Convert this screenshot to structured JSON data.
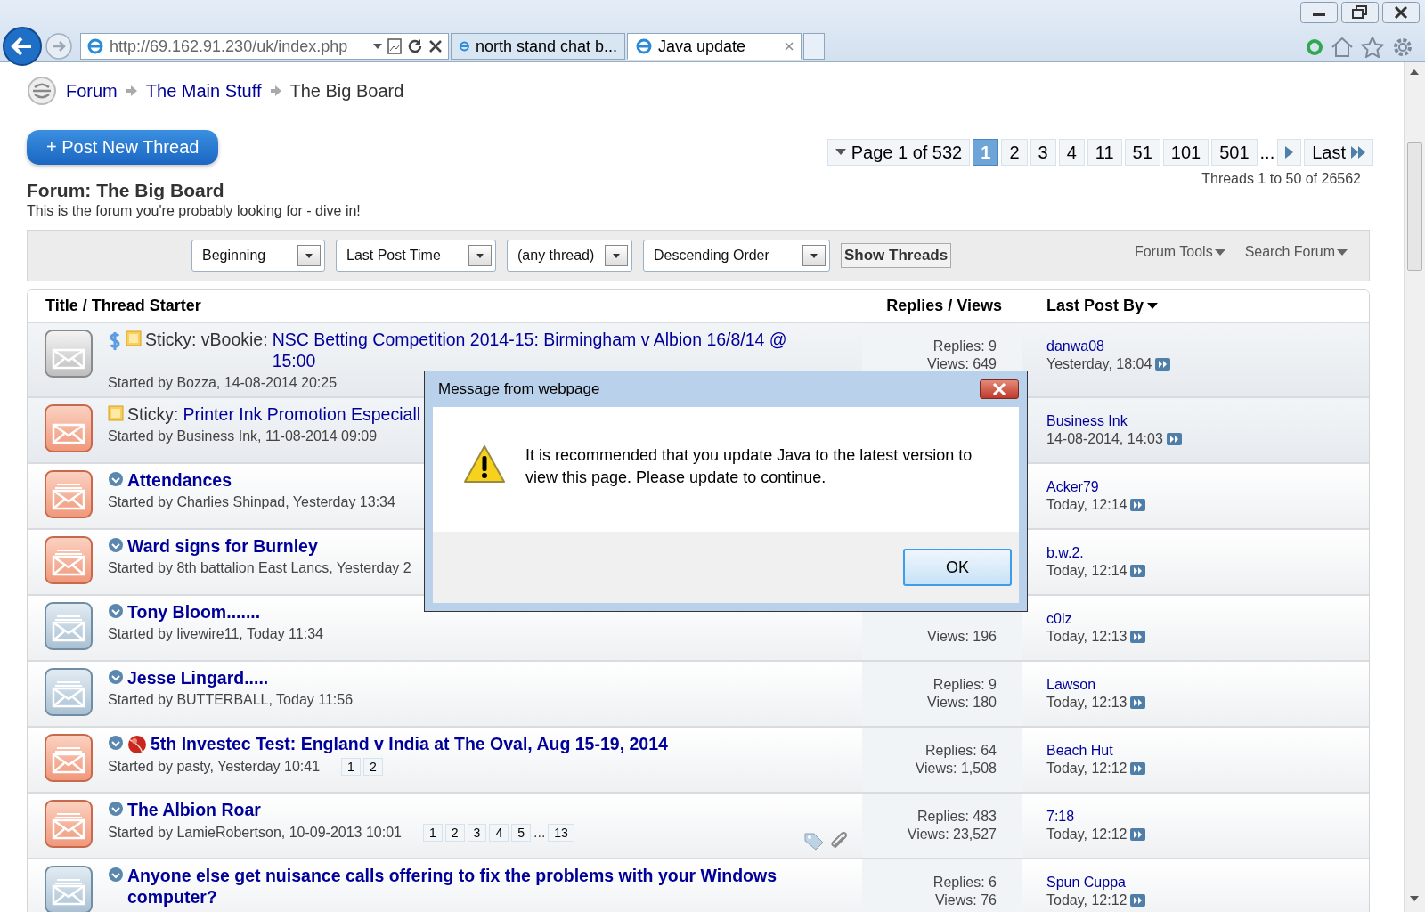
{
  "browser": {
    "address": "http://69.162.91.230/uk/index.php",
    "tabs": [
      {
        "title": "north stand chat b...",
        "selected": false
      },
      {
        "title": "Java update",
        "selected": true
      }
    ]
  },
  "breadcrumb": [
    {
      "label": "Forum",
      "kind": "link"
    },
    {
      "label": "The Main Stuff",
      "kind": "link"
    },
    {
      "label": "The Big Board",
      "kind": "current"
    }
  ],
  "post_button": "+ Post New Thread",
  "pagination": {
    "label": "Page 1 of 532",
    "pages": [
      {
        "label": "1",
        "selected": true
      },
      {
        "label": "2",
        "selected": false
      },
      {
        "label": "3",
        "selected": false
      },
      {
        "label": "4",
        "selected": false
      },
      {
        "label": "11",
        "selected": false
      },
      {
        "label": "51",
        "selected": false
      },
      {
        "label": "101",
        "selected": false
      },
      {
        "label": "501",
        "selected": false
      }
    ],
    "ellipsis": "...",
    "last": "Last"
  },
  "threads_count": "Threads 1 to 50 of 26562",
  "forum": {
    "title": "Forum: The Big Board",
    "description": "This is the forum you're probably looking for - dive in!"
  },
  "filters": {
    "selects": [
      "Beginning",
      "Last Post Time",
      "(any thread)",
      "Descending Order"
    ],
    "button": "Show Threads",
    "menus": [
      "Forum Tools",
      "Search Forum"
    ]
  },
  "table": {
    "columns": [
      "Title / Thread Starter",
      "Replies / Views",
      "Last Post By"
    ],
    "rows": [
      {
        "kind": "sticky-read",
        "sticky": true,
        "badges": [
          {
            "kind": "dollar"
          },
          {
            "kind": "note"
          }
        ],
        "prefix": "Sticky: vBookie:",
        "title": "NSC Betting Competition 2014-15: Birmingham v Albion 16/8/14 @ 15:00",
        "starter": "Started by Bozza, 14-08-2014 20:25",
        "replies": "Replies: 9",
        "views": "Views: 649",
        "last_by": "danwa08",
        "last_time": "Yesterday, 18:04"
      },
      {
        "kind": "sticky-new",
        "sticky": true,
        "badges": [
          {
            "kind": "note"
          }
        ],
        "prefix": "Sticky:",
        "title": "Printer Ink Promotion Especiall",
        "starter": "Started by Business Ink, 11-08-2014 09:09",
        "last_by": "Business Ink",
        "last_time": "14-08-2014, 14:03"
      },
      {
        "kind": "hot-new",
        "sticky": false,
        "badges": [
          {
            "kind": "thread"
          }
        ],
        "title": "Attendances",
        "starter": "Started by Charlies Shinpad, Yesterday 13:34",
        "last_by": "Acker79",
        "last_time": "Today, 12:14"
      },
      {
        "kind": "hot-new",
        "sticky": false,
        "badges": [
          {
            "kind": "thread"
          }
        ],
        "title": "Ward signs for Burnley",
        "starter": "Started by 8th battalion East Lancs, Yesterday 2",
        "last_by": "b.w.2.",
        "last_time": "Today, 12:14"
      },
      {
        "kind": "hot-read",
        "sticky": false,
        "badges": [
          {
            "kind": "thread"
          }
        ],
        "title": "Tony Bloom.......",
        "starter": "Started by livewire11, Today 11:34",
        "views": "Views: 196",
        "last_by": "c0lz",
        "last_time": "Today, 12:13"
      },
      {
        "kind": "hot-read",
        "sticky": false,
        "badges": [
          {
            "kind": "thread"
          }
        ],
        "title": "Jesse Lingard.....",
        "starter": "Started by BUTTERBALL, Today 11:56",
        "replies": "Replies: 9",
        "views": "Views: 180",
        "last_by": "Lawson",
        "last_time": "Today, 12:13"
      },
      {
        "kind": "hot-new",
        "sticky": false,
        "badges": [
          {
            "kind": "thread"
          },
          {
            "kind": "ball"
          }
        ],
        "title": "5th Investec Test: England v India at The Oval, Aug 15-19, 2014",
        "starter": "Started by pasty, Yesterday 10:41",
        "pages": [
          "1",
          "2"
        ],
        "replies": "Replies: 64",
        "views": "Views: 1,508",
        "last_by": "Beach Hut",
        "last_time": "Today, 12:12"
      },
      {
        "kind": "hot-new",
        "sticky": false,
        "badges": [
          {
            "kind": "thread"
          }
        ],
        "title": "The Albion Roar",
        "starter": "Started by LamieRobertson, 10-09-2013 10:01",
        "pages": [
          "1",
          "2",
          "3",
          "4",
          "5"
        ],
        "pages_ellipsis": "...",
        "last_page": "13",
        "extras": [
          {
            "kind": "tag"
          },
          {
            "kind": "paperclip"
          }
        ],
        "replies": "Replies: 483",
        "views": "Views: 23,527",
        "last_by": "7:18",
        "last_time": "Today, 12:12"
      },
      {
        "kind": "hot-read",
        "sticky": false,
        "badges": [
          {
            "kind": "thread"
          }
        ],
        "title": "Anyone else get nuisance calls offering to fix the problems with your Windows computer?",
        "replies": "Replies: 6",
        "views": "Views: 76",
        "last_by": "Spun Cuppa",
        "last_time": "Today, 12:12"
      }
    ]
  },
  "dialog": {
    "title": "Message from webpage",
    "message": "It is recommended that you update Java to the latest version to view this page. Please update to continue.",
    "button": "OK"
  }
}
